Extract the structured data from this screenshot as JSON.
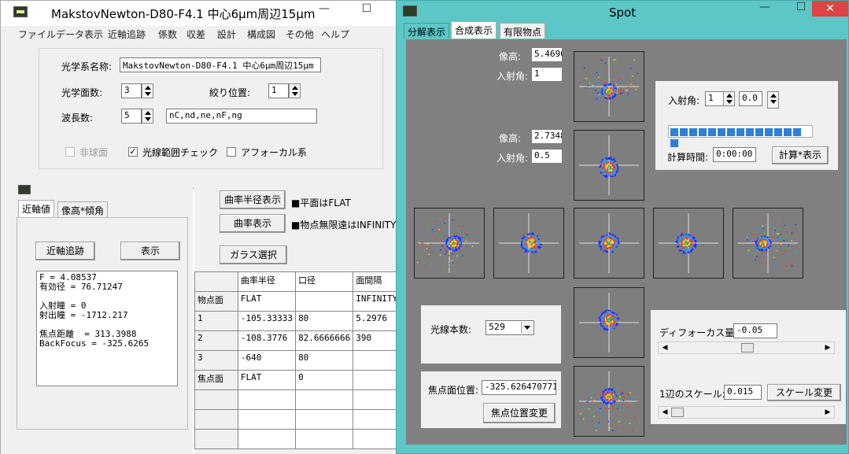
{
  "main_window": {
    "title": "MakstovNewton-D80-F4.1  中心6μm周辺15μm",
    "menu": [
      "ファイル",
      "データ表示",
      "近軸追跡",
      "係数",
      "収差",
      "設計",
      "構成図",
      "その他",
      "ヘルプ"
    ],
    "system_name_label": "光学系名称:",
    "system_name_value": "MakstovNewton-D80-F4.1  中心6μm周辺15μm",
    "surfaces_label": "光学面数:",
    "surfaces_value": "3",
    "stop_label": "絞り位置:",
    "stop_value": "1",
    "wavelengths_label": "波長数:",
    "wavelengths_value": "5",
    "wavelength_list": "nC,nd,ne,nF,ng",
    "aspheric_label": "非球面",
    "ray_range_label": "光線範囲チェック",
    "ray_range_checked": "✓",
    "afocal_label": "アフォーカル系"
  },
  "paraxial_window": {
    "tabs": [
      "近軸値",
      "像高*傾角"
    ],
    "trace_button": "近軸追跡",
    "show_button": "表示",
    "results": "F = 4.08537\n有効径 = 76.71247\n\n入射瞳 = 0\n射出瞳 = -1712.217\n\n焦点距離  = 313.3988\nBackFocus = -325.6265"
  },
  "lens_table": {
    "radius_button": "曲率半径表示",
    "curvature_button": "曲率表示",
    "glass_button": "ガラス選択",
    "note1": "■平面はFLAT",
    "note2": "■物点無限遠はINFINITY",
    "headers": [
      "",
      "曲率半径",
      "口径",
      "面間隔"
    ],
    "rows": [
      [
        "物点面",
        "FLAT",
        "",
        "INFINITY"
      ],
      [
        "1",
        "-105.33333",
        "80",
        "5.2976"
      ],
      [
        "2",
        "-108.3776",
        "82.6666666",
        "390"
      ],
      [
        "3",
        "-640",
        "80",
        ""
      ],
      [
        "焦点面",
        "FLAT",
        "0",
        ""
      ],
      [
        "",
        "",
        "",
        ""
      ],
      [
        "",
        "",
        "",
        ""
      ],
      [
        "",
        "",
        "",
        ""
      ]
    ]
  },
  "spot_window": {
    "title": "Spot",
    "tabs": [
      "分解表示",
      "合成表示",
      "有限物点"
    ],
    "img_height_label": "像高:",
    "img_height_1": "5.4696",
    "angle_label": "入射角:",
    "angle_1": "1",
    "img_height_2": "2.7348",
    "angle_2": "0.5",
    "incidence_label": "入射角:",
    "incidence_deg": "1",
    "incidence_min": "0.0",
    "calc_time_label": "計算時間:",
    "calc_time": "0:00:00",
    "calc_button": "計算*表示",
    "progress": 1.0,
    "rays_label": "光線本数:",
    "rays_value": "529",
    "focus_pos_label": "焦点面位置:",
    "focus_pos_value": "-325.6264707719",
    "focus_change_button": "焦点位置変更",
    "defocus_label": "ディフォーカス量:",
    "defocus_value": "-0.05",
    "defocus_slider": 0.5,
    "scale_label": "1辺のスケール:",
    "scale_value": "0.015",
    "scale_button": "スケール変更",
    "scale_slider": 0.0
  },
  "colors": {
    "spot_bg": "#5dc6c6",
    "plot_bg": "#808080",
    "accent": "#2d7fd8"
  }
}
